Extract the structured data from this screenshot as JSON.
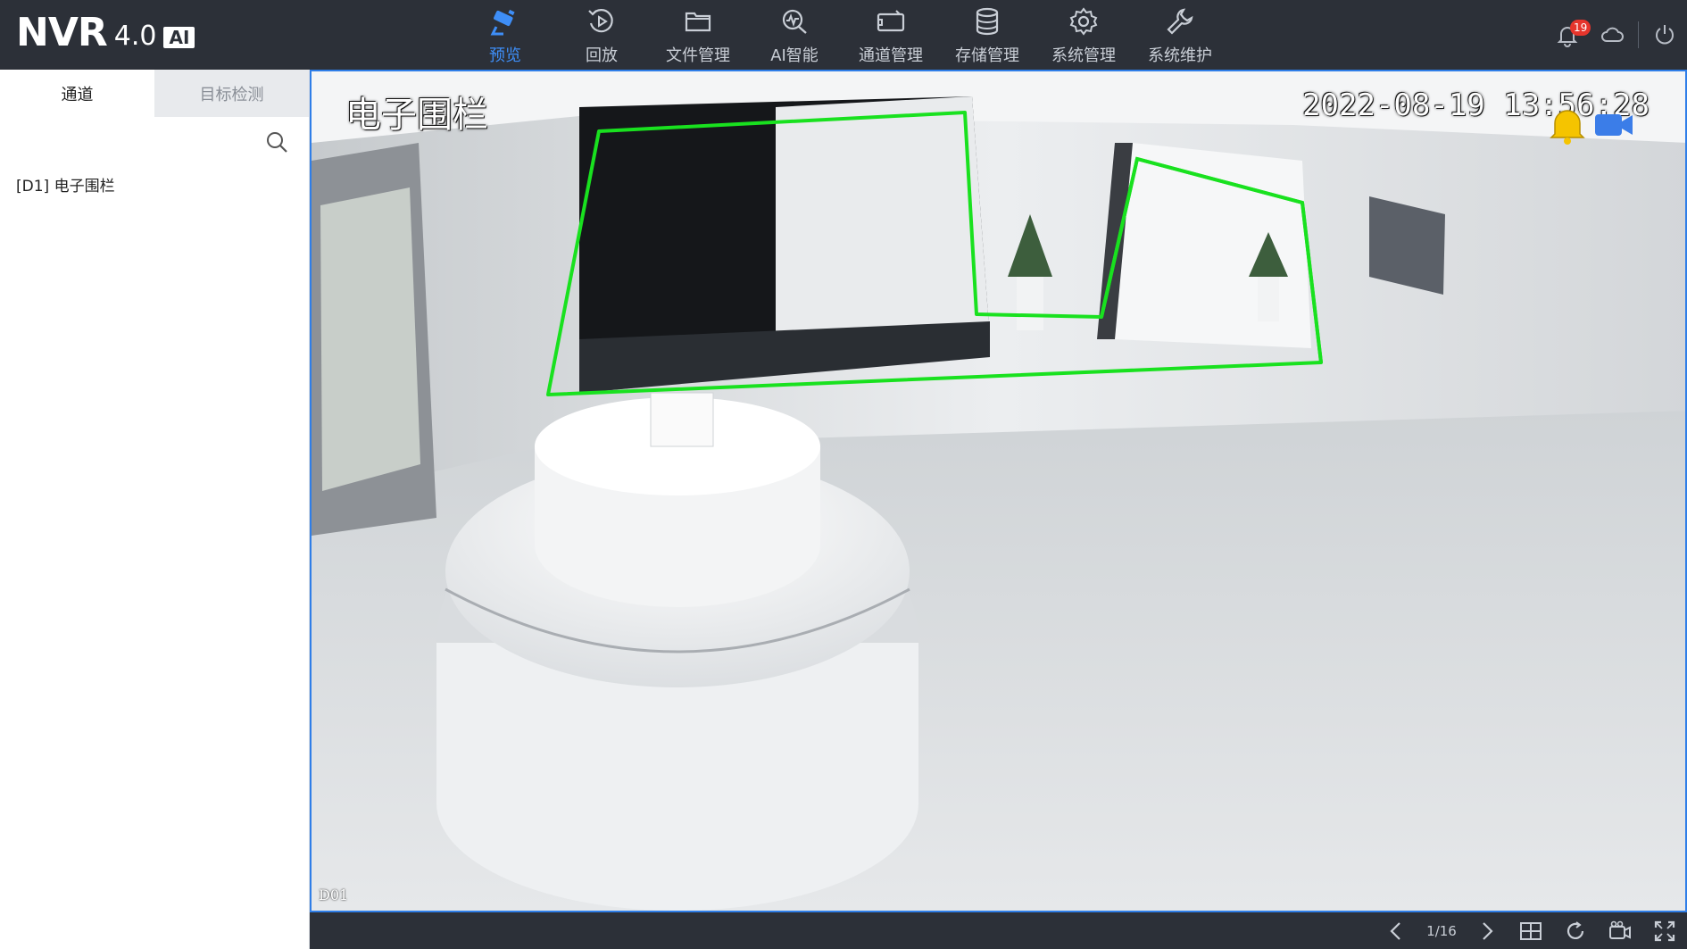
{
  "logo": {
    "name": "NVR",
    "version": "4.0",
    "ai": "AI"
  },
  "nav": [
    {
      "label": "预览",
      "icon": "camera-icon",
      "active": true
    },
    {
      "label": "回放",
      "icon": "playback-icon",
      "active": false
    },
    {
      "label": "文件管理",
      "icon": "folder-icon",
      "active": false
    },
    {
      "label": "AI智能",
      "icon": "ai-icon",
      "active": false
    },
    {
      "label": "通道管理",
      "icon": "channel-icon",
      "active": false
    },
    {
      "label": "存储管理",
      "icon": "database-icon",
      "active": false
    },
    {
      "label": "系统管理",
      "icon": "gear-icon",
      "active": false
    },
    {
      "label": "系统维护",
      "icon": "wrench-icon",
      "active": false
    }
  ],
  "topright": {
    "notification_count": "19"
  },
  "sidebar": {
    "tabs": [
      {
        "label": "通道",
        "active": true
      },
      {
        "label": "目标检测",
        "active": false
      }
    ],
    "search": {
      "value": "",
      "placeholder": ""
    },
    "channels": [
      {
        "label": "[D1] 电子围栏"
      }
    ]
  },
  "video": {
    "osd_title": "电子围栏",
    "osd_time": "2022-08-19 13:56:28",
    "channel_label": "D01"
  },
  "bottombar": {
    "page": "1/16"
  },
  "colors": {
    "topbar": "#2c3038",
    "accent": "#3e8ef7",
    "fence": "#19e11f",
    "badge": "#e6352c"
  }
}
